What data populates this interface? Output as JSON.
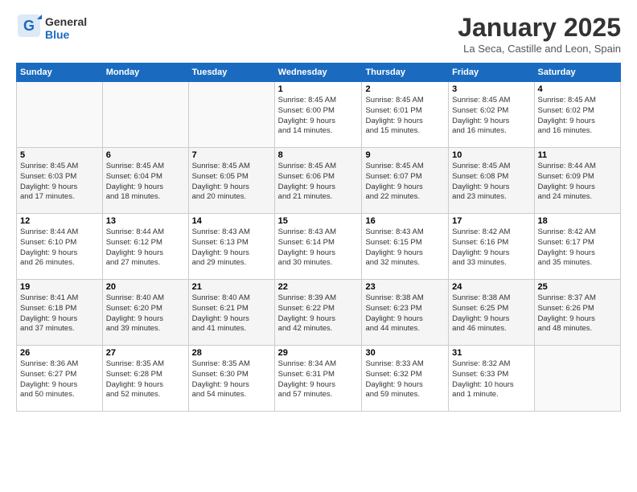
{
  "logo": {
    "line1": "General",
    "line2": "Blue"
  },
  "title": "January 2025",
  "location": "La Seca, Castille and Leon, Spain",
  "weekdays": [
    "Sunday",
    "Monday",
    "Tuesday",
    "Wednesday",
    "Thursday",
    "Friday",
    "Saturday"
  ],
  "weeks": [
    [
      {
        "day": "",
        "info": ""
      },
      {
        "day": "",
        "info": ""
      },
      {
        "day": "",
        "info": ""
      },
      {
        "day": "1",
        "info": "Sunrise: 8:45 AM\nSunset: 6:00 PM\nDaylight: 9 hours\nand 14 minutes."
      },
      {
        "day": "2",
        "info": "Sunrise: 8:45 AM\nSunset: 6:01 PM\nDaylight: 9 hours\nand 15 minutes."
      },
      {
        "day": "3",
        "info": "Sunrise: 8:45 AM\nSunset: 6:02 PM\nDaylight: 9 hours\nand 16 minutes."
      },
      {
        "day": "4",
        "info": "Sunrise: 8:45 AM\nSunset: 6:02 PM\nDaylight: 9 hours\nand 16 minutes."
      }
    ],
    [
      {
        "day": "5",
        "info": "Sunrise: 8:45 AM\nSunset: 6:03 PM\nDaylight: 9 hours\nand 17 minutes."
      },
      {
        "day": "6",
        "info": "Sunrise: 8:45 AM\nSunset: 6:04 PM\nDaylight: 9 hours\nand 18 minutes."
      },
      {
        "day": "7",
        "info": "Sunrise: 8:45 AM\nSunset: 6:05 PM\nDaylight: 9 hours\nand 20 minutes."
      },
      {
        "day": "8",
        "info": "Sunrise: 8:45 AM\nSunset: 6:06 PM\nDaylight: 9 hours\nand 21 minutes."
      },
      {
        "day": "9",
        "info": "Sunrise: 8:45 AM\nSunset: 6:07 PM\nDaylight: 9 hours\nand 22 minutes."
      },
      {
        "day": "10",
        "info": "Sunrise: 8:45 AM\nSunset: 6:08 PM\nDaylight: 9 hours\nand 23 minutes."
      },
      {
        "day": "11",
        "info": "Sunrise: 8:44 AM\nSunset: 6:09 PM\nDaylight: 9 hours\nand 24 minutes."
      }
    ],
    [
      {
        "day": "12",
        "info": "Sunrise: 8:44 AM\nSunset: 6:10 PM\nDaylight: 9 hours\nand 26 minutes."
      },
      {
        "day": "13",
        "info": "Sunrise: 8:44 AM\nSunset: 6:12 PM\nDaylight: 9 hours\nand 27 minutes."
      },
      {
        "day": "14",
        "info": "Sunrise: 8:43 AM\nSunset: 6:13 PM\nDaylight: 9 hours\nand 29 minutes."
      },
      {
        "day": "15",
        "info": "Sunrise: 8:43 AM\nSunset: 6:14 PM\nDaylight: 9 hours\nand 30 minutes."
      },
      {
        "day": "16",
        "info": "Sunrise: 8:43 AM\nSunset: 6:15 PM\nDaylight: 9 hours\nand 32 minutes."
      },
      {
        "day": "17",
        "info": "Sunrise: 8:42 AM\nSunset: 6:16 PM\nDaylight: 9 hours\nand 33 minutes."
      },
      {
        "day": "18",
        "info": "Sunrise: 8:42 AM\nSunset: 6:17 PM\nDaylight: 9 hours\nand 35 minutes."
      }
    ],
    [
      {
        "day": "19",
        "info": "Sunrise: 8:41 AM\nSunset: 6:18 PM\nDaylight: 9 hours\nand 37 minutes."
      },
      {
        "day": "20",
        "info": "Sunrise: 8:40 AM\nSunset: 6:20 PM\nDaylight: 9 hours\nand 39 minutes."
      },
      {
        "day": "21",
        "info": "Sunrise: 8:40 AM\nSunset: 6:21 PM\nDaylight: 9 hours\nand 41 minutes."
      },
      {
        "day": "22",
        "info": "Sunrise: 8:39 AM\nSunset: 6:22 PM\nDaylight: 9 hours\nand 42 minutes."
      },
      {
        "day": "23",
        "info": "Sunrise: 8:38 AM\nSunset: 6:23 PM\nDaylight: 9 hours\nand 44 minutes."
      },
      {
        "day": "24",
        "info": "Sunrise: 8:38 AM\nSunset: 6:25 PM\nDaylight: 9 hours\nand 46 minutes."
      },
      {
        "day": "25",
        "info": "Sunrise: 8:37 AM\nSunset: 6:26 PM\nDaylight: 9 hours\nand 48 minutes."
      }
    ],
    [
      {
        "day": "26",
        "info": "Sunrise: 8:36 AM\nSunset: 6:27 PM\nDaylight: 9 hours\nand 50 minutes."
      },
      {
        "day": "27",
        "info": "Sunrise: 8:35 AM\nSunset: 6:28 PM\nDaylight: 9 hours\nand 52 minutes."
      },
      {
        "day": "28",
        "info": "Sunrise: 8:35 AM\nSunset: 6:30 PM\nDaylight: 9 hours\nand 54 minutes."
      },
      {
        "day": "29",
        "info": "Sunrise: 8:34 AM\nSunset: 6:31 PM\nDaylight: 9 hours\nand 57 minutes."
      },
      {
        "day": "30",
        "info": "Sunrise: 8:33 AM\nSunset: 6:32 PM\nDaylight: 9 hours\nand 59 minutes."
      },
      {
        "day": "31",
        "info": "Sunrise: 8:32 AM\nSunset: 6:33 PM\nDaylight: 10 hours\nand 1 minute."
      },
      {
        "day": "",
        "info": ""
      }
    ]
  ]
}
